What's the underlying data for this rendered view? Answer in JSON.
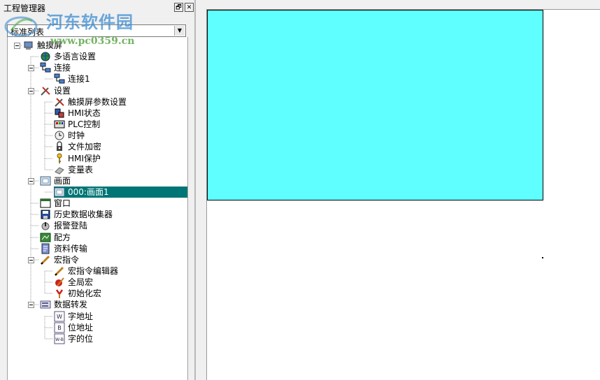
{
  "panel": {
    "title": "工程管理器",
    "pin_glyph": "🗗",
    "close_glyph": "✕",
    "combo_value": "标准列表"
  },
  "tree": [
    {
      "label": "触摸屏",
      "icon": "hmi-device-icon",
      "level": 0,
      "expanded": true
    },
    {
      "label": "多语言设置",
      "icon": "globe-icon",
      "level": 1
    },
    {
      "label": "连接",
      "icon": "network-icon",
      "level": 1,
      "expanded": true
    },
    {
      "label": "连接1",
      "icon": "network-icon",
      "level": 2
    },
    {
      "label": "设置",
      "icon": "tools-icon",
      "level": 1,
      "expanded": true
    },
    {
      "label": "触摸屏参数设置",
      "icon": "tools-icon",
      "level": 2
    },
    {
      "label": "HMI状态",
      "icon": "status-icon",
      "level": 2
    },
    {
      "label": "PLC控制",
      "icon": "plc-icon",
      "level": 2
    },
    {
      "label": "时钟",
      "icon": "clock-icon",
      "level": 2
    },
    {
      "label": "文件加密",
      "icon": "lock-icon",
      "level": 2
    },
    {
      "label": "HMI保护",
      "icon": "key-icon",
      "level": 2
    },
    {
      "label": "变量表",
      "icon": "eraser-icon",
      "level": 2
    },
    {
      "label": "画面",
      "icon": "screen-icon",
      "level": 1,
      "expanded": true
    },
    {
      "label": "000:画面1",
      "icon": "screen-icon",
      "level": 2,
      "selected": true
    },
    {
      "label": "窗口",
      "icon": "window-icon",
      "level": 1
    },
    {
      "label": "历史数据收集器",
      "icon": "disk-icon",
      "level": 1
    },
    {
      "label": "报警登陆",
      "icon": "alarm-icon",
      "level": 1
    },
    {
      "label": "配方",
      "icon": "recipe-icon",
      "level": 1
    },
    {
      "label": "资料传输",
      "icon": "transfer-icon",
      "level": 1
    },
    {
      "label": "宏指令",
      "icon": "pencil-icon",
      "level": 1,
      "expanded": true
    },
    {
      "label": "宏指令编辑器",
      "icon": "pencil-icon",
      "level": 2
    },
    {
      "label": "全局宏",
      "icon": "global-macro-icon",
      "level": 2
    },
    {
      "label": "初始化宏",
      "icon": "init-macro-icon",
      "level": 2
    },
    {
      "label": "数据转发",
      "icon": "forward-icon",
      "level": 1,
      "expanded": true
    },
    {
      "label": "字地址",
      "icon": "word-address-icon",
      "level": 2
    },
    {
      "label": "位地址",
      "icon": "bit-address-icon",
      "level": 2
    },
    {
      "label": "字的位",
      "icon": "word-bit-icon",
      "level": 2
    }
  ],
  "watermark": {
    "title": "河东软件园",
    "url": "www.pc0359.cn"
  },
  "colors": {
    "screen_fill": "#60ffff",
    "selection": "#007575"
  }
}
